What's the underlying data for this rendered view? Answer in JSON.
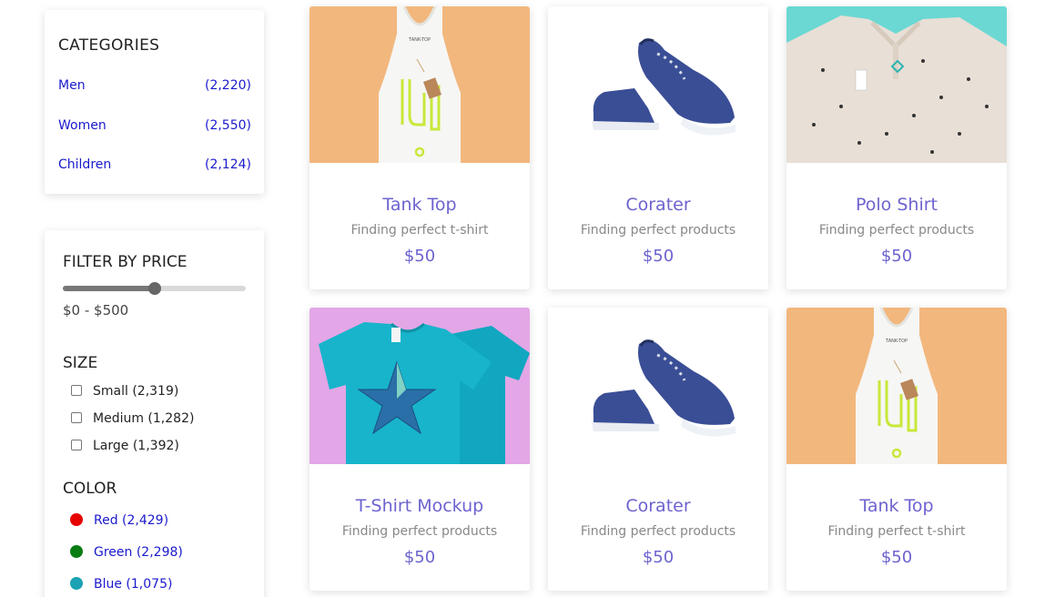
{
  "categories": {
    "title": "CATEGORIES",
    "items": [
      {
        "label": "Men",
        "count": "(2,220)"
      },
      {
        "label": "Women",
        "count": "(2,550)"
      },
      {
        "label": "Children",
        "count": "(2,124)"
      }
    ]
  },
  "price_filter": {
    "title": "FILTER BY PRICE",
    "range_label": "$0 - $500",
    "slider_level": 0.5
  },
  "size_filter": {
    "title": "SIZE",
    "options": [
      {
        "label": "Small (2,319)",
        "checked": false
      },
      {
        "label": "Medium (1,282)",
        "checked": false
      },
      {
        "label": "Large (1,392)",
        "checked": false
      }
    ]
  },
  "color_filter": {
    "title": "COLOR",
    "options": [
      {
        "label": "Red (2,429)",
        "swatch": "#e60000"
      },
      {
        "label": "Green (2,298)",
        "swatch": "#0a7d12"
      },
      {
        "label": "Blue (1,075)",
        "swatch": "#1ba3b3"
      }
    ]
  },
  "products": [
    {
      "name": "Tank Top",
      "desc": "Finding perfect t-shirt",
      "price": "$50",
      "image": "tank-top",
      "bg": "#f2b77d"
    },
    {
      "name": "Corater",
      "desc": "Finding perfect products",
      "price": "$50",
      "image": "sneaker",
      "bg": "#ffffff"
    },
    {
      "name": "Polo Shirt",
      "desc": "Finding perfect products",
      "price": "$50",
      "image": "polo-shirt",
      "bg": "#6bd8d3"
    },
    {
      "name": "T-Shirt Mockup",
      "desc": "Finding perfect products",
      "price": "$50",
      "image": "tshirt",
      "bg": "#e3a6e6"
    },
    {
      "name": "Corater",
      "desc": "Finding perfect products",
      "price": "$50",
      "image": "sneaker",
      "bg": "#ffffff"
    },
    {
      "name": "Tank Top",
      "desc": "Finding perfect t-shirt",
      "price": "$50",
      "image": "tank-top",
      "bg": "#f2b77d"
    }
  ],
  "tank_tag_text": "TANK-TOP"
}
